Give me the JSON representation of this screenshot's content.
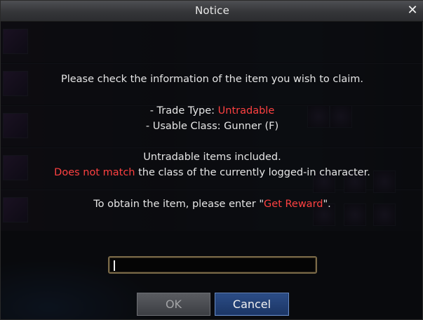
{
  "dialog": {
    "title": "Notice",
    "close_glyph": "✕"
  },
  "message": {
    "line1": "Please check the information of the item you wish to claim.",
    "trade_type_label": "- Trade Type: ",
    "trade_type_value": "Untradable",
    "usable_class": "- Usable Class: Gunner (F)",
    "untradable_note": "Untradable items included.",
    "mismatch_highlight": "Does not match",
    "mismatch_rest": " the class of the currently logged-in character.",
    "obtain_prefix": "To obtain the item, please enter \"",
    "obtain_keyword": "Get Reward",
    "obtain_suffix": "\"."
  },
  "input": {
    "value": ""
  },
  "buttons": {
    "ok_label": "OK",
    "cancel_label": "Cancel"
  },
  "colors": {
    "highlight": "#ff4141",
    "cancel_button": "#1b3564"
  }
}
